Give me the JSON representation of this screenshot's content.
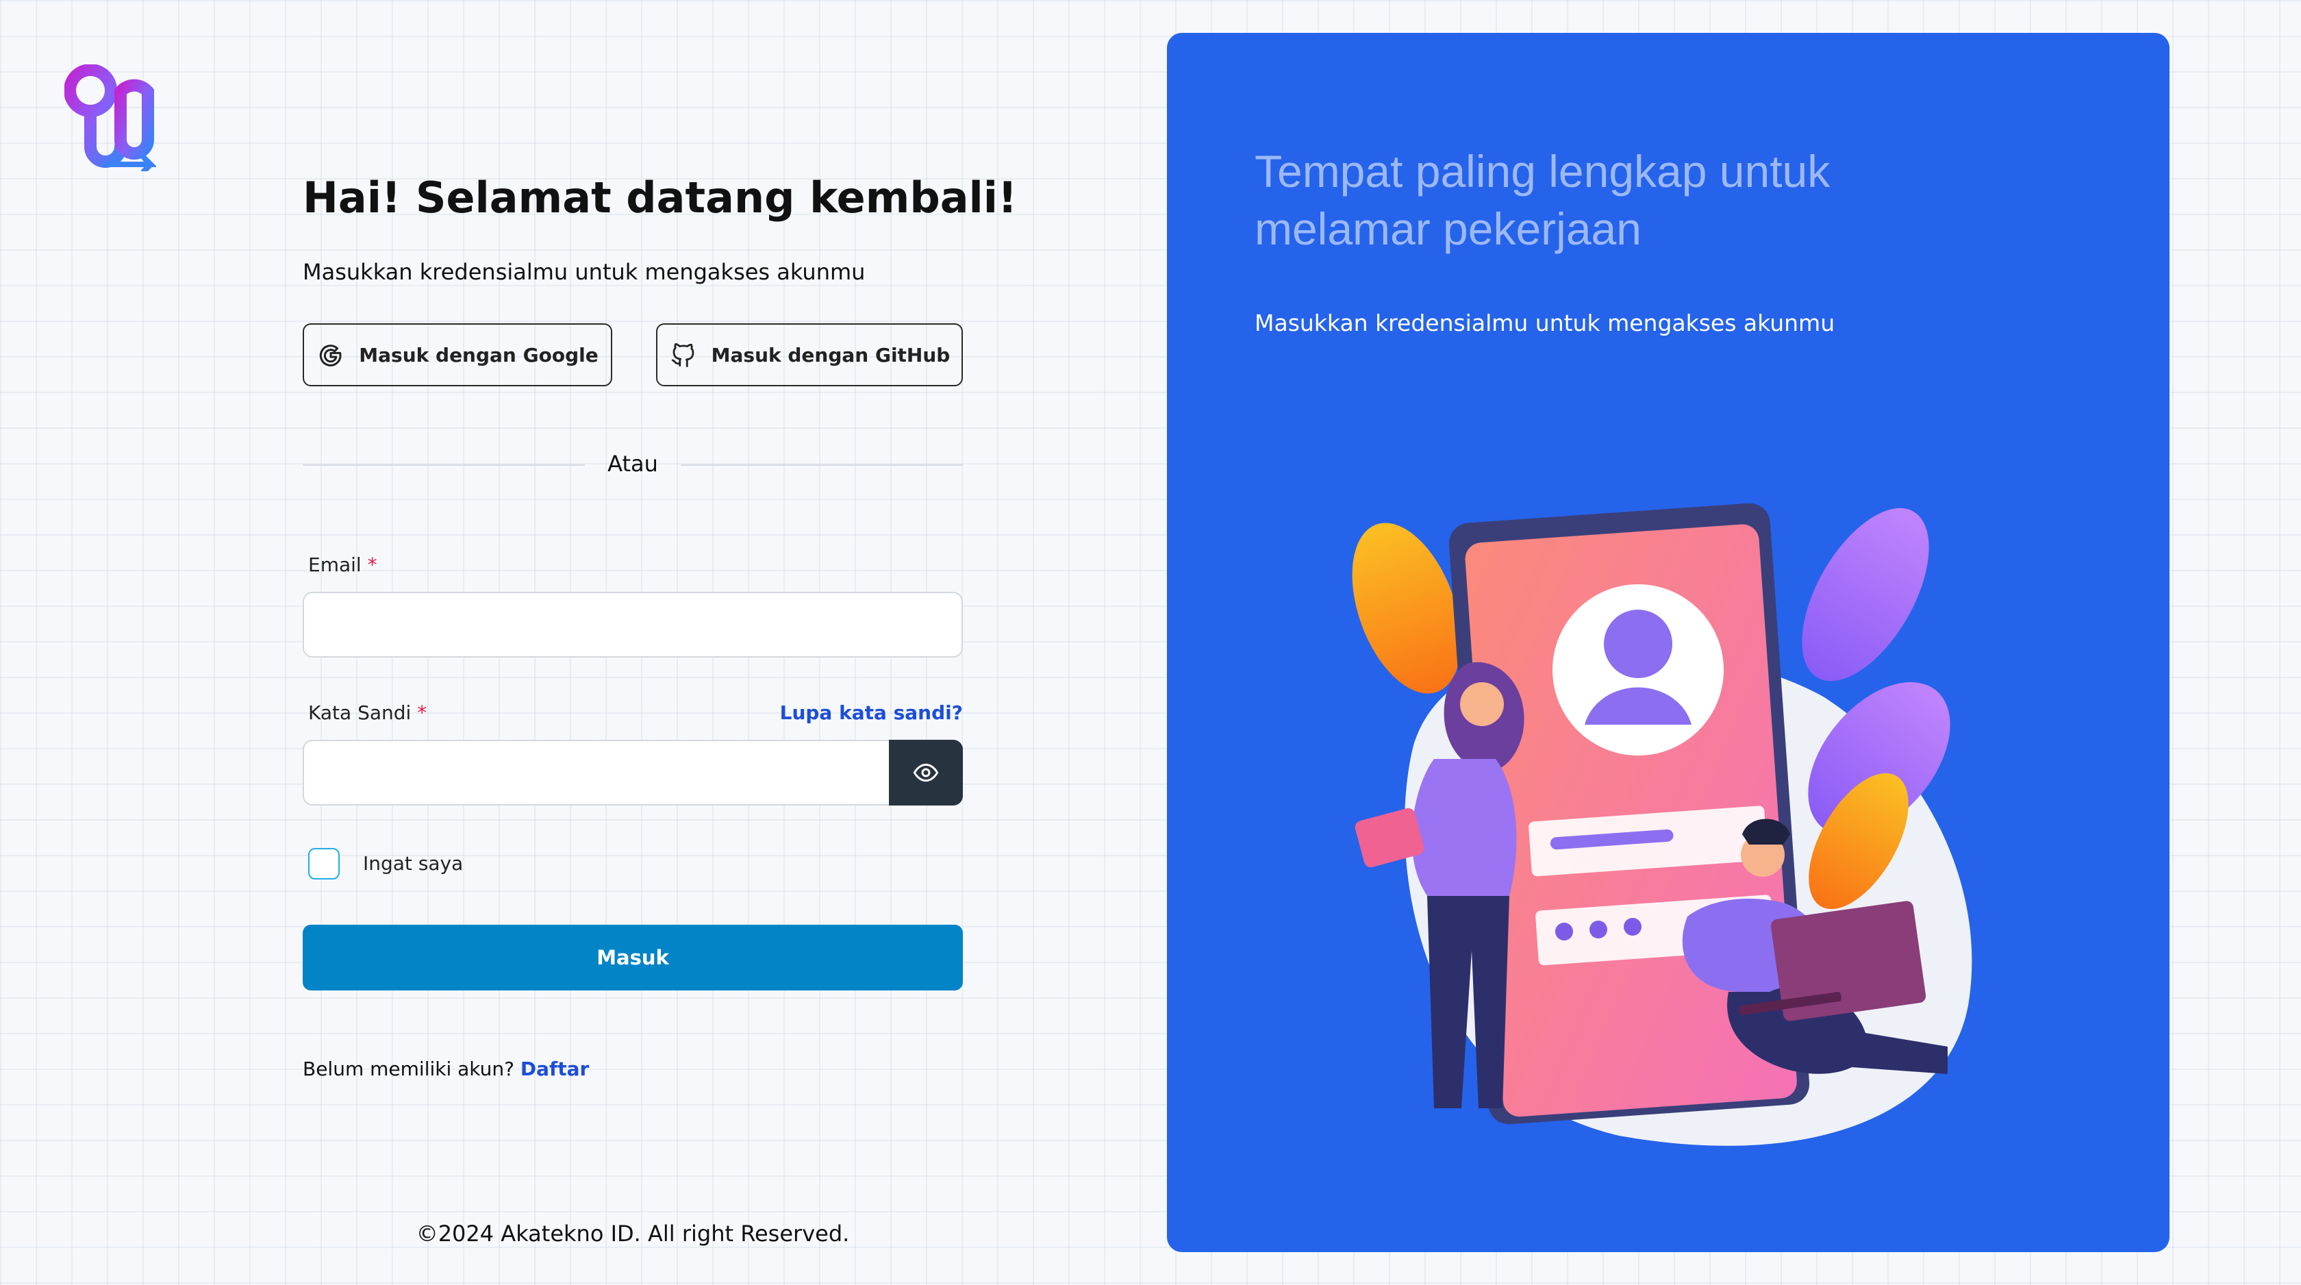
{
  "colors": {
    "primary_button": "#0284c7",
    "panel_background": "#2563eb",
    "link": "#1d4ed8",
    "required_marker": "#e11d48",
    "eye_button": "#283340"
  },
  "header": {
    "logo_icon": "akatekno-logo"
  },
  "login": {
    "title": "Hai! Selamat datang kembali!",
    "subtitle": "Masukkan kredensialmu untuk mengakses akunmu",
    "google_button": "Masuk dengan Google",
    "github_button": "Masuk dengan GitHub",
    "divider": "Atau",
    "email_label": "Email",
    "password_label": "Kata Sandi",
    "required_marker": "*",
    "forgot_password": "Lupa kata sandi?",
    "email_value": "",
    "password_value": "",
    "remember_me": "Ingat saya",
    "remember_checked": false,
    "submit": "Masuk",
    "no_account": "Belum memiliki akun?",
    "register_link": "Daftar"
  },
  "footer": {
    "copyright": "©2024 Akatekno ID. All right Reserved."
  },
  "panel": {
    "title": "Tempat paling lengkap untuk melamar pekerjaan",
    "subtitle": "Masukkan kredensialmu untuk mengakses akunmu",
    "illustration": "phone-login-illustration"
  }
}
